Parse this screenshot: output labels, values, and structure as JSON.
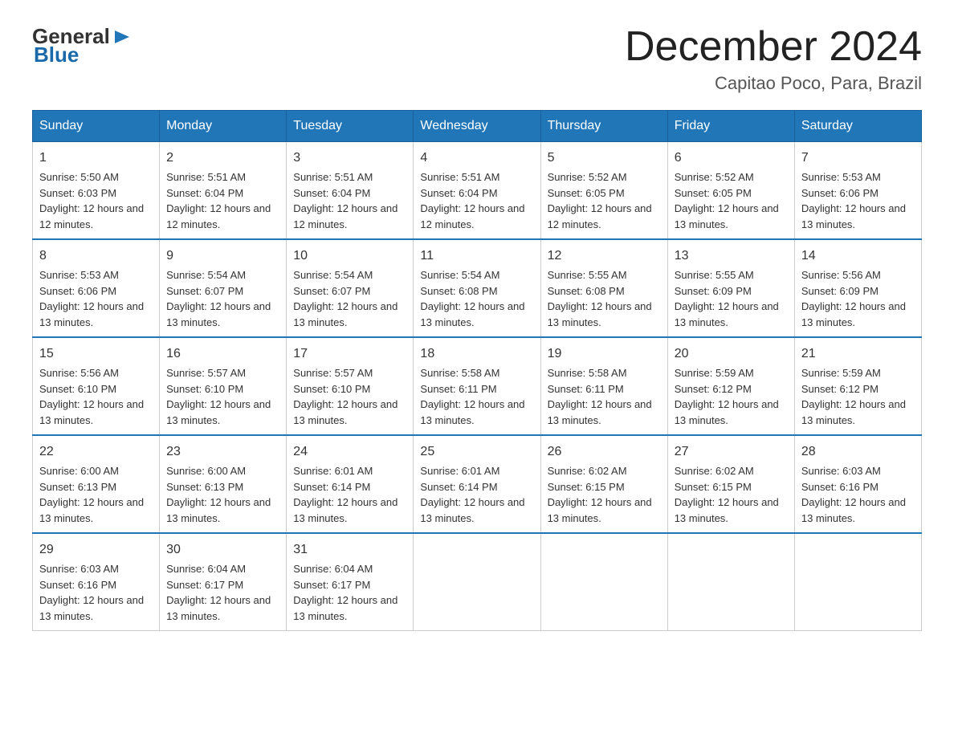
{
  "logo": {
    "general": "General",
    "arrow": "▶",
    "blue": "Blue"
  },
  "title": "December 2024",
  "location": "Capitao Poco, Para, Brazil",
  "days_of_week": [
    "Sunday",
    "Monday",
    "Tuesday",
    "Wednesday",
    "Thursday",
    "Friday",
    "Saturday"
  ],
  "weeks": [
    [
      {
        "day": "1",
        "sunrise": "5:50 AM",
        "sunset": "6:03 PM",
        "daylight": "12 hours and 12 minutes."
      },
      {
        "day": "2",
        "sunrise": "5:51 AM",
        "sunset": "6:04 PM",
        "daylight": "12 hours and 12 minutes."
      },
      {
        "day": "3",
        "sunrise": "5:51 AM",
        "sunset": "6:04 PM",
        "daylight": "12 hours and 12 minutes."
      },
      {
        "day": "4",
        "sunrise": "5:51 AM",
        "sunset": "6:04 PM",
        "daylight": "12 hours and 12 minutes."
      },
      {
        "day": "5",
        "sunrise": "5:52 AM",
        "sunset": "6:05 PM",
        "daylight": "12 hours and 12 minutes."
      },
      {
        "day": "6",
        "sunrise": "5:52 AM",
        "sunset": "6:05 PM",
        "daylight": "12 hours and 13 minutes."
      },
      {
        "day": "7",
        "sunrise": "5:53 AM",
        "sunset": "6:06 PM",
        "daylight": "12 hours and 13 minutes."
      }
    ],
    [
      {
        "day": "8",
        "sunrise": "5:53 AM",
        "sunset": "6:06 PM",
        "daylight": "12 hours and 13 minutes."
      },
      {
        "day": "9",
        "sunrise": "5:54 AM",
        "sunset": "6:07 PM",
        "daylight": "12 hours and 13 minutes."
      },
      {
        "day": "10",
        "sunrise": "5:54 AM",
        "sunset": "6:07 PM",
        "daylight": "12 hours and 13 minutes."
      },
      {
        "day": "11",
        "sunrise": "5:54 AM",
        "sunset": "6:08 PM",
        "daylight": "12 hours and 13 minutes."
      },
      {
        "day": "12",
        "sunrise": "5:55 AM",
        "sunset": "6:08 PM",
        "daylight": "12 hours and 13 minutes."
      },
      {
        "day": "13",
        "sunrise": "5:55 AM",
        "sunset": "6:09 PM",
        "daylight": "12 hours and 13 minutes."
      },
      {
        "day": "14",
        "sunrise": "5:56 AM",
        "sunset": "6:09 PM",
        "daylight": "12 hours and 13 minutes."
      }
    ],
    [
      {
        "day": "15",
        "sunrise": "5:56 AM",
        "sunset": "6:10 PM",
        "daylight": "12 hours and 13 minutes."
      },
      {
        "day": "16",
        "sunrise": "5:57 AM",
        "sunset": "6:10 PM",
        "daylight": "12 hours and 13 minutes."
      },
      {
        "day": "17",
        "sunrise": "5:57 AM",
        "sunset": "6:10 PM",
        "daylight": "12 hours and 13 minutes."
      },
      {
        "day": "18",
        "sunrise": "5:58 AM",
        "sunset": "6:11 PM",
        "daylight": "12 hours and 13 minutes."
      },
      {
        "day": "19",
        "sunrise": "5:58 AM",
        "sunset": "6:11 PM",
        "daylight": "12 hours and 13 minutes."
      },
      {
        "day": "20",
        "sunrise": "5:59 AM",
        "sunset": "6:12 PM",
        "daylight": "12 hours and 13 minutes."
      },
      {
        "day": "21",
        "sunrise": "5:59 AM",
        "sunset": "6:12 PM",
        "daylight": "12 hours and 13 minutes."
      }
    ],
    [
      {
        "day": "22",
        "sunrise": "6:00 AM",
        "sunset": "6:13 PM",
        "daylight": "12 hours and 13 minutes."
      },
      {
        "day": "23",
        "sunrise": "6:00 AM",
        "sunset": "6:13 PM",
        "daylight": "12 hours and 13 minutes."
      },
      {
        "day": "24",
        "sunrise": "6:01 AM",
        "sunset": "6:14 PM",
        "daylight": "12 hours and 13 minutes."
      },
      {
        "day": "25",
        "sunrise": "6:01 AM",
        "sunset": "6:14 PM",
        "daylight": "12 hours and 13 minutes."
      },
      {
        "day": "26",
        "sunrise": "6:02 AM",
        "sunset": "6:15 PM",
        "daylight": "12 hours and 13 minutes."
      },
      {
        "day": "27",
        "sunrise": "6:02 AM",
        "sunset": "6:15 PM",
        "daylight": "12 hours and 13 minutes."
      },
      {
        "day": "28",
        "sunrise": "6:03 AM",
        "sunset": "6:16 PM",
        "daylight": "12 hours and 13 minutes."
      }
    ],
    [
      {
        "day": "29",
        "sunrise": "6:03 AM",
        "sunset": "6:16 PM",
        "daylight": "12 hours and 13 minutes."
      },
      {
        "day": "30",
        "sunrise": "6:04 AM",
        "sunset": "6:17 PM",
        "daylight": "12 hours and 13 minutes."
      },
      {
        "day": "31",
        "sunrise": "6:04 AM",
        "sunset": "6:17 PM",
        "daylight": "12 hours and 13 minutes."
      },
      null,
      null,
      null,
      null
    ]
  ]
}
